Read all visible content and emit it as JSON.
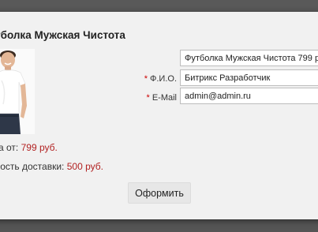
{
  "product": {
    "title": "тболка Мужская Чистота",
    "price_label": "а от: ",
    "price_value": "799 руб.",
    "delivery_label": "мость доставки: ",
    "delivery_value": "500 руб."
  },
  "form": {
    "product_field_value": "Футболка Мужская Чистота 799 руб.",
    "name_label": "Ф.И.О.",
    "name_value": "Битрикс Разработчик",
    "email_label": "E-Mail",
    "email_value": "admin@admin.ru",
    "required_marker": "*",
    "submit_label": "Оформить"
  },
  "colors": {
    "price_accent": "#b22222",
    "required_marker": "#cc0000"
  }
}
